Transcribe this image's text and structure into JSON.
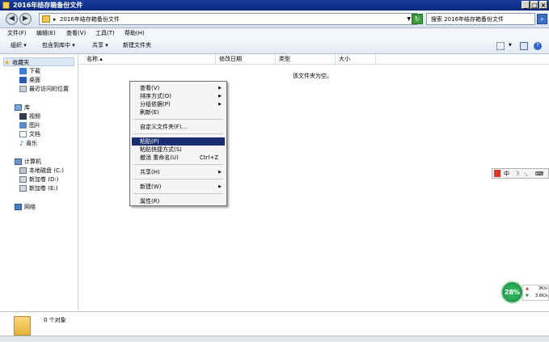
{
  "window": {
    "title": "2016年结存箱备份文件",
    "min": "_",
    "max": "□",
    "close": "×"
  },
  "address": {
    "separator": "▸",
    "path": "2016年结存箱备份文件",
    "search_placeholder": "搜索 2016年结存箱备份文件"
  },
  "menubar": [
    "文件(F)",
    "编辑(E)",
    "查看(V)",
    "工具(T)",
    "帮助(H)"
  ],
  "toolbar": {
    "organize": "组织 ▾",
    "include": "包含到库中 ▾",
    "share": "共享 ▾",
    "new_folder": "新建文件夹"
  },
  "nav": {
    "favorites": "收藏夹",
    "fav_items": [
      "下载",
      "桌面",
      "最近访问的位置"
    ],
    "libraries": "库",
    "lib_items": [
      "视频",
      "图片",
      "文档",
      "音乐"
    ],
    "computer": "计算机",
    "computer_items": [
      "本地磁盘 (C:)",
      "新加卷 (D:)",
      "新加卷 (E:)"
    ],
    "network": "网络"
  },
  "columns": {
    "name": "名称 ▴",
    "date": "修改日期",
    "type": "类型",
    "size": "大小"
  },
  "empty_message": "该文件夹为空。",
  "context_menu": {
    "view": "查看(V)",
    "sort": "排序方式(O)",
    "group": "分组依据(P)",
    "refresh": "刷新(E)",
    "customize": "自定义文件夹(F)...",
    "paste": "粘贴(P)",
    "paste_shortcut": "粘贴快捷方式(S)",
    "undo_rename": "撤消 重命名(U)",
    "undo_shortcut": "Ctrl+Z",
    "share": "共享(H)",
    "new": "新建(W)",
    "properties": "属性(R)"
  },
  "status": {
    "count": "0 个对象"
  },
  "ime": {
    "items": [
      "中",
      "☽",
      "·,",
      "⌨"
    ]
  },
  "speed": {
    "percent": "28%",
    "up": "3K/s",
    "down": "3.6K/s"
  }
}
